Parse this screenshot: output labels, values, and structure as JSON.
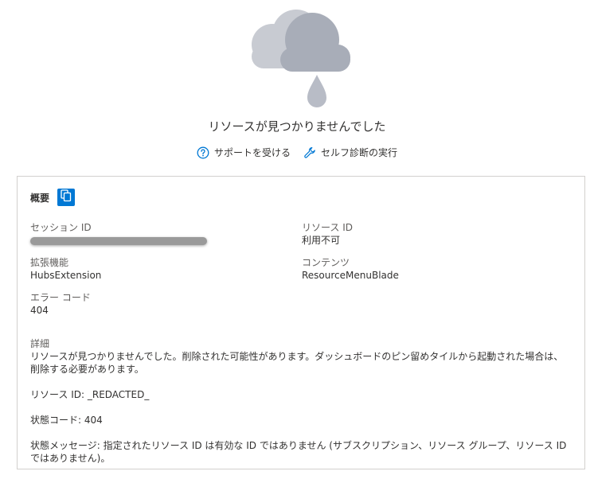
{
  "error": {
    "title": "リソースが見つかりませんでした"
  },
  "actions": {
    "support_label": "サポートを受ける",
    "diagnose_label": "セルフ診断の実行"
  },
  "summary": {
    "title": "概要",
    "session_id_label": "セッション ID",
    "resource_id_label": "リソース ID",
    "resource_id_value": "利用不可",
    "extension_label": "拡張機能",
    "extension_value": "HubsExtension",
    "content_label": "コンテンツ",
    "content_value": "ResourceMenuBlade",
    "error_code_label": "エラー コード",
    "error_code_value": "404",
    "details_label": "詳細",
    "details_message": "リソースが見つかりませんでした。削除された可能性があります。ダッシュボードのピン留めタイルから起動された場合は、削除する必要があります。",
    "details_resource_id": "リソース ID: _REDACTED_",
    "details_status_code": "状態コード: 404",
    "details_status_message": "状態メッセージ: 指定されたリソース ID は有効な ID ではありません (サブスクリプション、リソース グループ、リソース ID ではありません)。"
  },
  "colors": {
    "accent": "#0078d4",
    "cloud_back": "#c8cbd2",
    "cloud_front": "#a8adb8",
    "drop": "#b8bcc6"
  },
  "icons": {
    "hero": "cloud-rain-icon",
    "support": "question-circle-icon",
    "diagnose": "wrench-icon",
    "copy": "copy-icon"
  }
}
